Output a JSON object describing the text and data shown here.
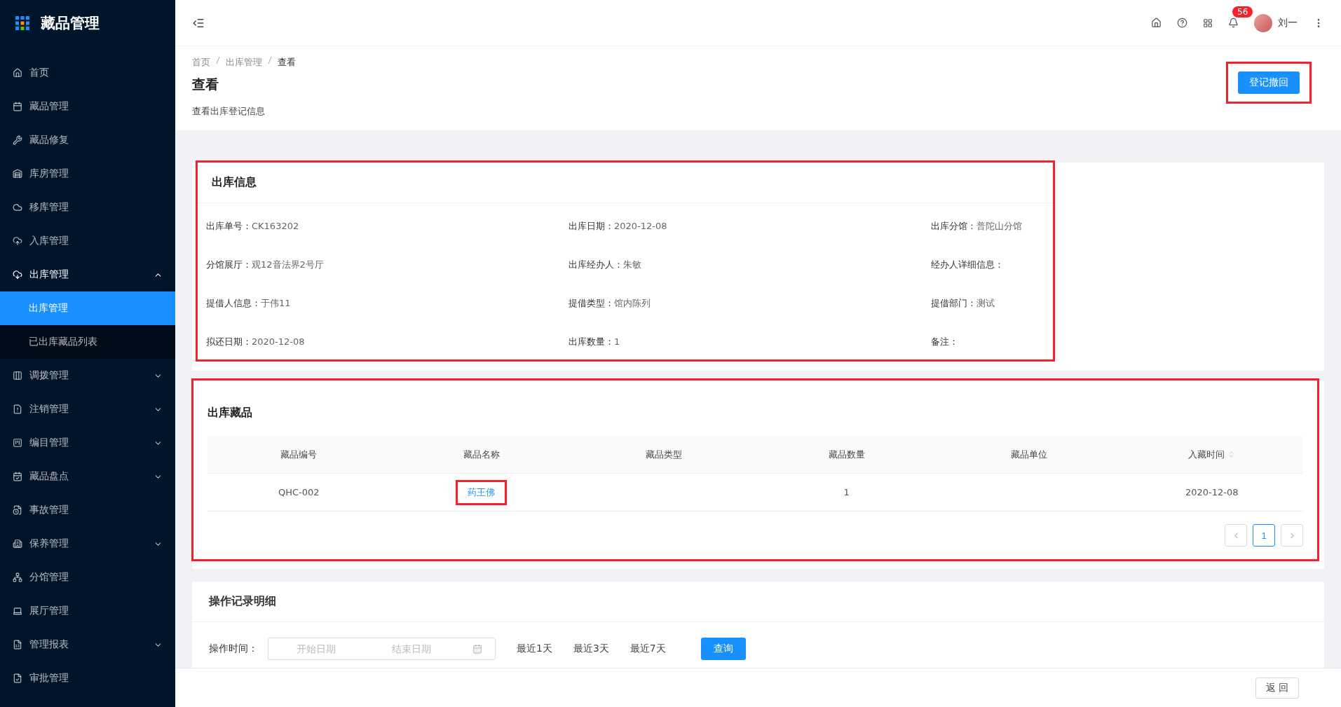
{
  "app": {
    "title": "藏品管理"
  },
  "sidebar": {
    "items": [
      {
        "label": "首页",
        "kind": "link"
      },
      {
        "label": "藏品管理",
        "kind": "link"
      },
      {
        "label": "藏品修复",
        "kind": "link"
      },
      {
        "label": "库房管理",
        "kind": "link"
      },
      {
        "label": "移库管理",
        "kind": "link"
      },
      {
        "label": "入库管理",
        "kind": "link"
      },
      {
        "label": "出库管理",
        "kind": "group",
        "expanded": true,
        "children": [
          {
            "label": "出库管理",
            "selected": true
          },
          {
            "label": "已出库藏品列表",
            "selected": false
          }
        ]
      },
      {
        "label": "调拨管理",
        "kind": "group",
        "expanded": false
      },
      {
        "label": "注销管理",
        "kind": "group",
        "expanded": false
      },
      {
        "label": "编目管理",
        "kind": "group",
        "expanded": false
      },
      {
        "label": "藏品盘点",
        "kind": "group",
        "expanded": false
      },
      {
        "label": "事故管理",
        "kind": "link"
      },
      {
        "label": "保养管理",
        "kind": "group",
        "expanded": false
      },
      {
        "label": "分馆管理",
        "kind": "link"
      },
      {
        "label": "展厅管理",
        "kind": "link"
      },
      {
        "label": "管理报表",
        "kind": "group",
        "expanded": false
      },
      {
        "label": "审批管理",
        "kind": "link"
      }
    ]
  },
  "header": {
    "notification_count": "56",
    "user_name": "刘一"
  },
  "page_header": {
    "breadcrumb": [
      "首页",
      "出库管理",
      "查看"
    ],
    "title": "查看",
    "subtitle": "查看出库登记信息",
    "action": {
      "label": "登记撤回",
      "highlighted": true
    }
  },
  "info": {
    "title": "出库信息",
    "highlighted": true,
    "fields": [
      {
        "label": "出库单号：",
        "value": "CK163202"
      },
      {
        "label": "出库日期：",
        "value": "2020-12-08"
      },
      {
        "label": "出库分馆：",
        "value": "普陀山分馆"
      },
      {
        "label": "分馆展厅：",
        "value": "观12音法界2号厅"
      },
      {
        "label": "出库经办人：",
        "value": "朱敏"
      },
      {
        "label": "经办人详细信息："
      },
      {
        "label": "提借人信息：",
        "value": "于伟11"
      },
      {
        "label": "提借类型：",
        "value": "馆内陈列"
      },
      {
        "label": "提借部门：",
        "value": "测试"
      },
      {
        "label": "拟还日期：",
        "value": "2020-12-08"
      },
      {
        "label": "出库数量：",
        "value": "1"
      },
      {
        "label": "备注："
      }
    ]
  },
  "items_table": {
    "title": "出库藏品",
    "highlighted": true,
    "columns": [
      {
        "label": "藏品编号",
        "sortable": false
      },
      {
        "label": "藏品名称",
        "sortable": false
      },
      {
        "label": "藏品类型",
        "sortable": false
      },
      {
        "label": "藏品数量",
        "sortable": false
      },
      {
        "label": "藏品单位",
        "sortable": false
      },
      {
        "label": "入藏时间",
        "sortable": true
      }
    ],
    "rows": [
      {
        "cells": [
          {
            "text": "QHC-002"
          },
          {
            "text": "药王佛",
            "kind": "link",
            "highlighted": true
          },
          {},
          {
            "text": "1"
          },
          {},
          {
            "text": "2020-12-08"
          }
        ]
      }
    ],
    "pages": [
      {
        "label": "1",
        "selected": true
      }
    ]
  },
  "operations": {
    "title": "操作记录明细",
    "filter_label": "操作时间：",
    "start_placeholder": "开始日期",
    "end_placeholder": "结束日期",
    "quick_ranges": [
      "最近1天",
      "最近3天",
      "最近7天"
    ],
    "search_button": "查询"
  },
  "footer": {
    "back_button": "返 回"
  }
}
